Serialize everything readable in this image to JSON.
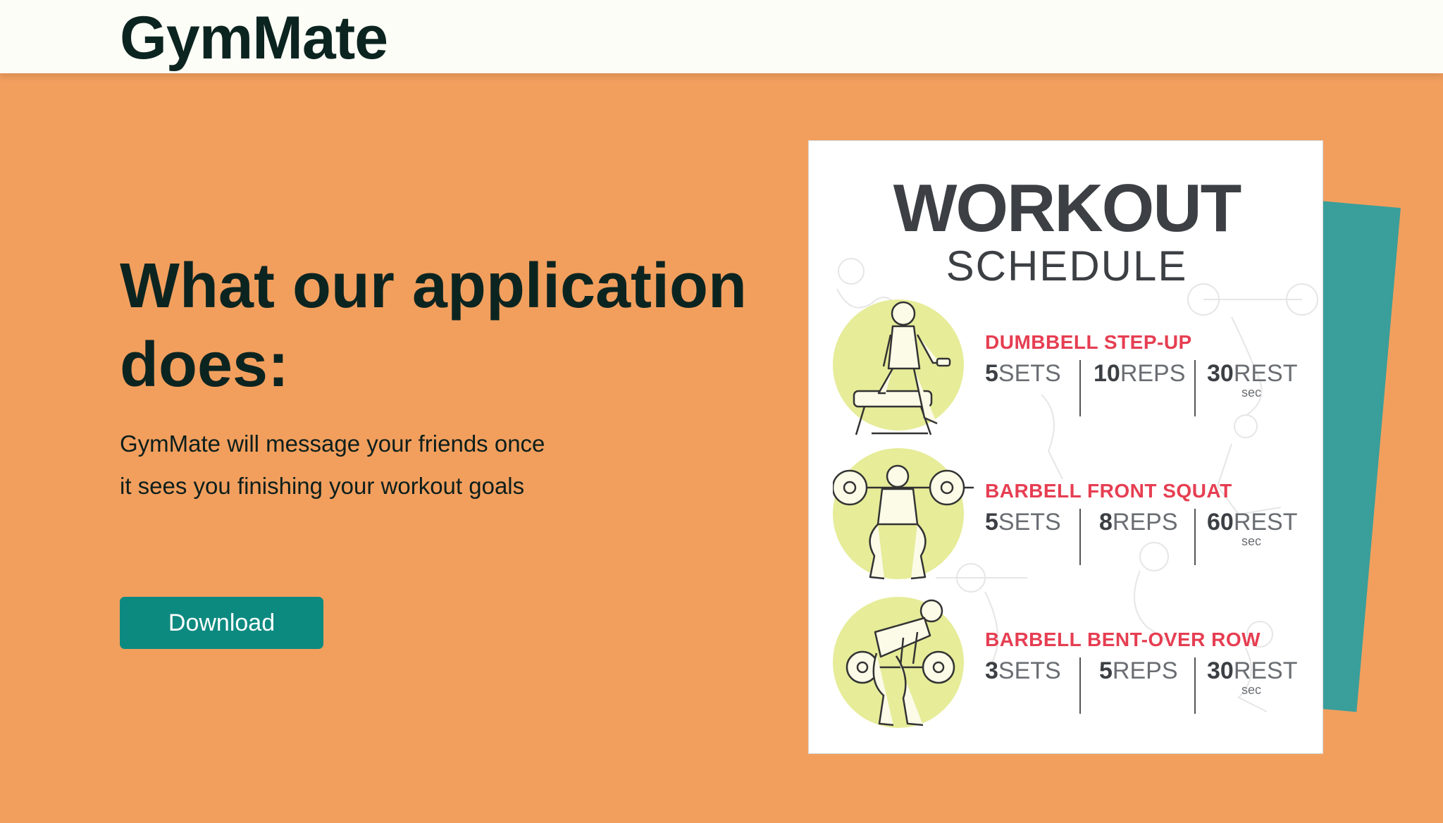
{
  "header": {
    "brand": "GymMate"
  },
  "hero": {
    "headline": "What our application does:",
    "description": "GymMate will message your friends once it sees you finishing your workout goals",
    "download_label": "Download"
  },
  "poster": {
    "title": "WORKOUT",
    "subtitle": "SCHEDULE",
    "unit_sec": "sec",
    "exercises": [
      {
        "name": "DUMBBELL STEP-UP",
        "sets": "5",
        "sets_unit": "SETS",
        "reps": "10",
        "reps_unit": "REPS",
        "rest": "30",
        "rest_unit": "REST"
      },
      {
        "name": "BARBELL FRONT SQUAT",
        "sets": "5",
        "sets_unit": "SETS",
        "reps": "8",
        "reps_unit": "REPS",
        "rest": "60",
        "rest_unit": "REST"
      },
      {
        "name": "BARBELL BENT-OVER ROW",
        "sets": "3",
        "sets_unit": "SETS",
        "reps": "5",
        "reps_unit": "REPS",
        "rest": "30",
        "rest_unit": "REST"
      }
    ]
  },
  "colors": {
    "background": "#f29f5e",
    "navbar": "#fdfdf7",
    "accent": "#0d8a80",
    "teal_card": "#3a9e9a",
    "exercise_name": "#e63e52",
    "circle": "#e6ec98"
  }
}
